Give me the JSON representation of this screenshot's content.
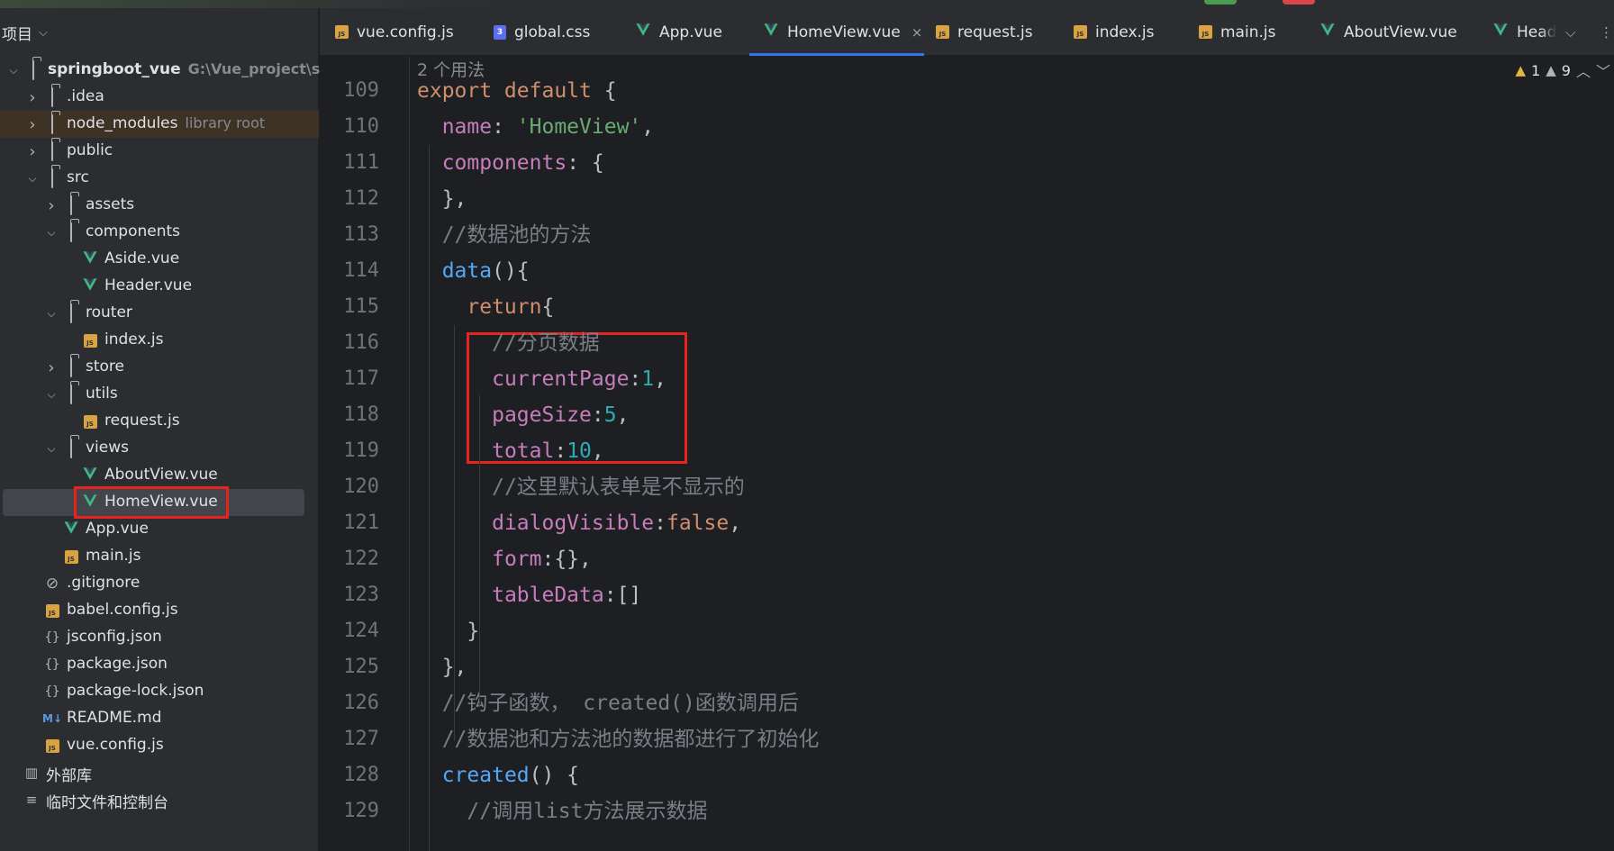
{
  "sidebar": {
    "title": "项目",
    "tree": [
      {
        "label": "springboot_vue",
        "extra": "G:\\Vue_project\\spring",
        "type": "folder-root",
        "depth": 0,
        "expanded": true,
        "bold": true
      },
      {
        "label": ".idea",
        "type": "folder",
        "depth": 1,
        "expanded": false
      },
      {
        "label": "node_modules",
        "extra": "library root",
        "type": "folder",
        "depth": 1,
        "expanded": false
      },
      {
        "label": "public",
        "type": "folder",
        "depth": 1,
        "expanded": false
      },
      {
        "label": "src",
        "type": "folder",
        "depth": 1,
        "expanded": true
      },
      {
        "label": "assets",
        "type": "folder",
        "depth": 2,
        "expanded": false
      },
      {
        "label": "components",
        "type": "folder",
        "depth": 2,
        "expanded": true
      },
      {
        "label": "Aside.vue",
        "type": "vue",
        "depth": 3
      },
      {
        "label": "Header.vue",
        "type": "vue",
        "depth": 3
      },
      {
        "label": "router",
        "type": "folder",
        "depth": 2,
        "expanded": true
      },
      {
        "label": "index.js",
        "type": "js",
        "depth": 3
      },
      {
        "label": "store",
        "type": "folder",
        "depth": 2,
        "expanded": false
      },
      {
        "label": "utils",
        "type": "folder",
        "depth": 2,
        "expanded": true
      },
      {
        "label": "request.js",
        "type": "js",
        "depth": 3
      },
      {
        "label": "views",
        "type": "folder",
        "depth": 2,
        "expanded": true
      },
      {
        "label": "AboutView.vue",
        "type": "vue",
        "depth": 3
      },
      {
        "label": "HomeView.vue",
        "type": "vue",
        "depth": 3,
        "selected": true
      },
      {
        "label": "App.vue",
        "type": "vue",
        "depth": 2
      },
      {
        "label": "main.js",
        "type": "js",
        "depth": 2
      },
      {
        "label": ".gitignore",
        "type": "ignore",
        "depth": 1
      },
      {
        "label": "babel.config.js",
        "type": "js",
        "depth": 1
      },
      {
        "label": "jsconfig.json",
        "type": "json",
        "depth": 1
      },
      {
        "label": "package.json",
        "type": "json",
        "depth": 1
      },
      {
        "label": "package-lock.json",
        "type": "json",
        "depth": 1
      },
      {
        "label": "README.md",
        "type": "md",
        "depth": 1
      },
      {
        "label": "vue.config.js",
        "type": "js",
        "depth": 1
      },
      {
        "label": "外部库",
        "type": "lib",
        "depth": 0
      },
      {
        "label": "临时文件和控制台",
        "type": "scratch",
        "depth": 0
      }
    ]
  },
  "tabs": [
    {
      "label": "vue.config.js",
      "type": "js"
    },
    {
      "label": "global.css",
      "type": "css"
    },
    {
      "label": "App.vue",
      "type": "vue"
    },
    {
      "label": "HomeView.vue",
      "type": "vue",
      "active": true
    },
    {
      "label": "request.js",
      "type": "js"
    },
    {
      "label": "index.js",
      "type": "js"
    },
    {
      "label": "main.js",
      "type": "js"
    },
    {
      "label": "AboutView.vue",
      "type": "vue"
    },
    {
      "label": "Head",
      "type": "vue"
    }
  ],
  "editor": {
    "usages": "2 个用法",
    "warnings": "1",
    "weak_warnings": "9",
    "lines": [
      {
        "no": "109",
        "tokens": [
          [
            "k",
            "export default "
          ],
          [
            "d",
            "{"
          ]
        ]
      },
      {
        "no": "110",
        "tokens": [
          [
            "d",
            "  "
          ],
          [
            "p",
            "name"
          ],
          [
            "d",
            ": "
          ],
          [
            "s",
            "'HomeView'"
          ],
          [
            "d",
            ","
          ]
        ]
      },
      {
        "no": "111",
        "tokens": [
          [
            "d",
            "  "
          ],
          [
            "p",
            "components"
          ],
          [
            "d",
            ": {"
          ]
        ]
      },
      {
        "no": "112",
        "tokens": [
          [
            "d",
            "  },"
          ]
        ]
      },
      {
        "no": "113",
        "tokens": [
          [
            "d",
            "  "
          ],
          [
            "c",
            "//数据池的方法"
          ]
        ]
      },
      {
        "no": "114",
        "tokens": [
          [
            "d",
            "  "
          ],
          [
            "f",
            "data"
          ],
          [
            "d",
            "(){"
          ]
        ]
      },
      {
        "no": "115",
        "tokens": [
          [
            "d",
            "    "
          ],
          [
            "k",
            "return"
          ],
          [
            "d",
            "{"
          ]
        ]
      },
      {
        "no": "116",
        "tokens": [
          [
            "d",
            "      "
          ],
          [
            "c",
            "//分页数据"
          ]
        ]
      },
      {
        "no": "117",
        "tokens": [
          [
            "d",
            "      "
          ],
          [
            "p",
            "currentPage"
          ],
          [
            "d",
            ":"
          ],
          [
            "n",
            "1"
          ],
          [
            "d",
            ","
          ]
        ]
      },
      {
        "no": "118",
        "tokens": [
          [
            "d",
            "      "
          ],
          [
            "p",
            "pageSize"
          ],
          [
            "d",
            ":"
          ],
          [
            "n",
            "5"
          ],
          [
            "d",
            ","
          ]
        ]
      },
      {
        "no": "119",
        "tokens": [
          [
            "d",
            "      "
          ],
          [
            "p",
            "total"
          ],
          [
            "d",
            ":"
          ],
          [
            "n",
            "10"
          ],
          [
            "d",
            ","
          ]
        ]
      },
      {
        "no": "120",
        "tokens": [
          [
            "d",
            "      "
          ],
          [
            "c",
            "//这里默认表单是不显示的"
          ]
        ]
      },
      {
        "no": "121",
        "tokens": [
          [
            "d",
            "      "
          ],
          [
            "p",
            "dialogVisible"
          ],
          [
            "d",
            ":"
          ],
          [
            "k",
            "false"
          ],
          [
            "d",
            ","
          ]
        ]
      },
      {
        "no": "122",
        "tokens": [
          [
            "d",
            "      "
          ],
          [
            "p",
            "form"
          ],
          [
            "d",
            ":{},"
          ]
        ]
      },
      {
        "no": "123",
        "tokens": [
          [
            "d",
            "      "
          ],
          [
            "p",
            "tableData"
          ],
          [
            "d",
            ":[]"
          ]
        ]
      },
      {
        "no": "124",
        "tokens": [
          [
            "d",
            "    }"
          ]
        ]
      },
      {
        "no": "125",
        "tokens": [
          [
            "d",
            "  },"
          ]
        ]
      },
      {
        "no": "126",
        "tokens": [
          [
            "d",
            "  "
          ],
          [
            "c",
            "//钩子函数， created()函数调用后"
          ]
        ]
      },
      {
        "no": "127",
        "tokens": [
          [
            "d",
            "  "
          ],
          [
            "c",
            "//数据池和方法池的数据都进行了初始化"
          ]
        ]
      },
      {
        "no": "128",
        "tokens": [
          [
            "d",
            "  "
          ],
          [
            "f",
            "created"
          ],
          [
            "d",
            "() {"
          ]
        ]
      },
      {
        "no": "129",
        "tokens": [
          [
            "d",
            "    "
          ],
          [
            "c",
            "//调用list方法展示数据"
          ]
        ]
      }
    ]
  },
  "colors": {
    "highlight_box": "#e5231f",
    "active_tab_underline": "#3574f0",
    "vue_green": "#41b883"
  }
}
